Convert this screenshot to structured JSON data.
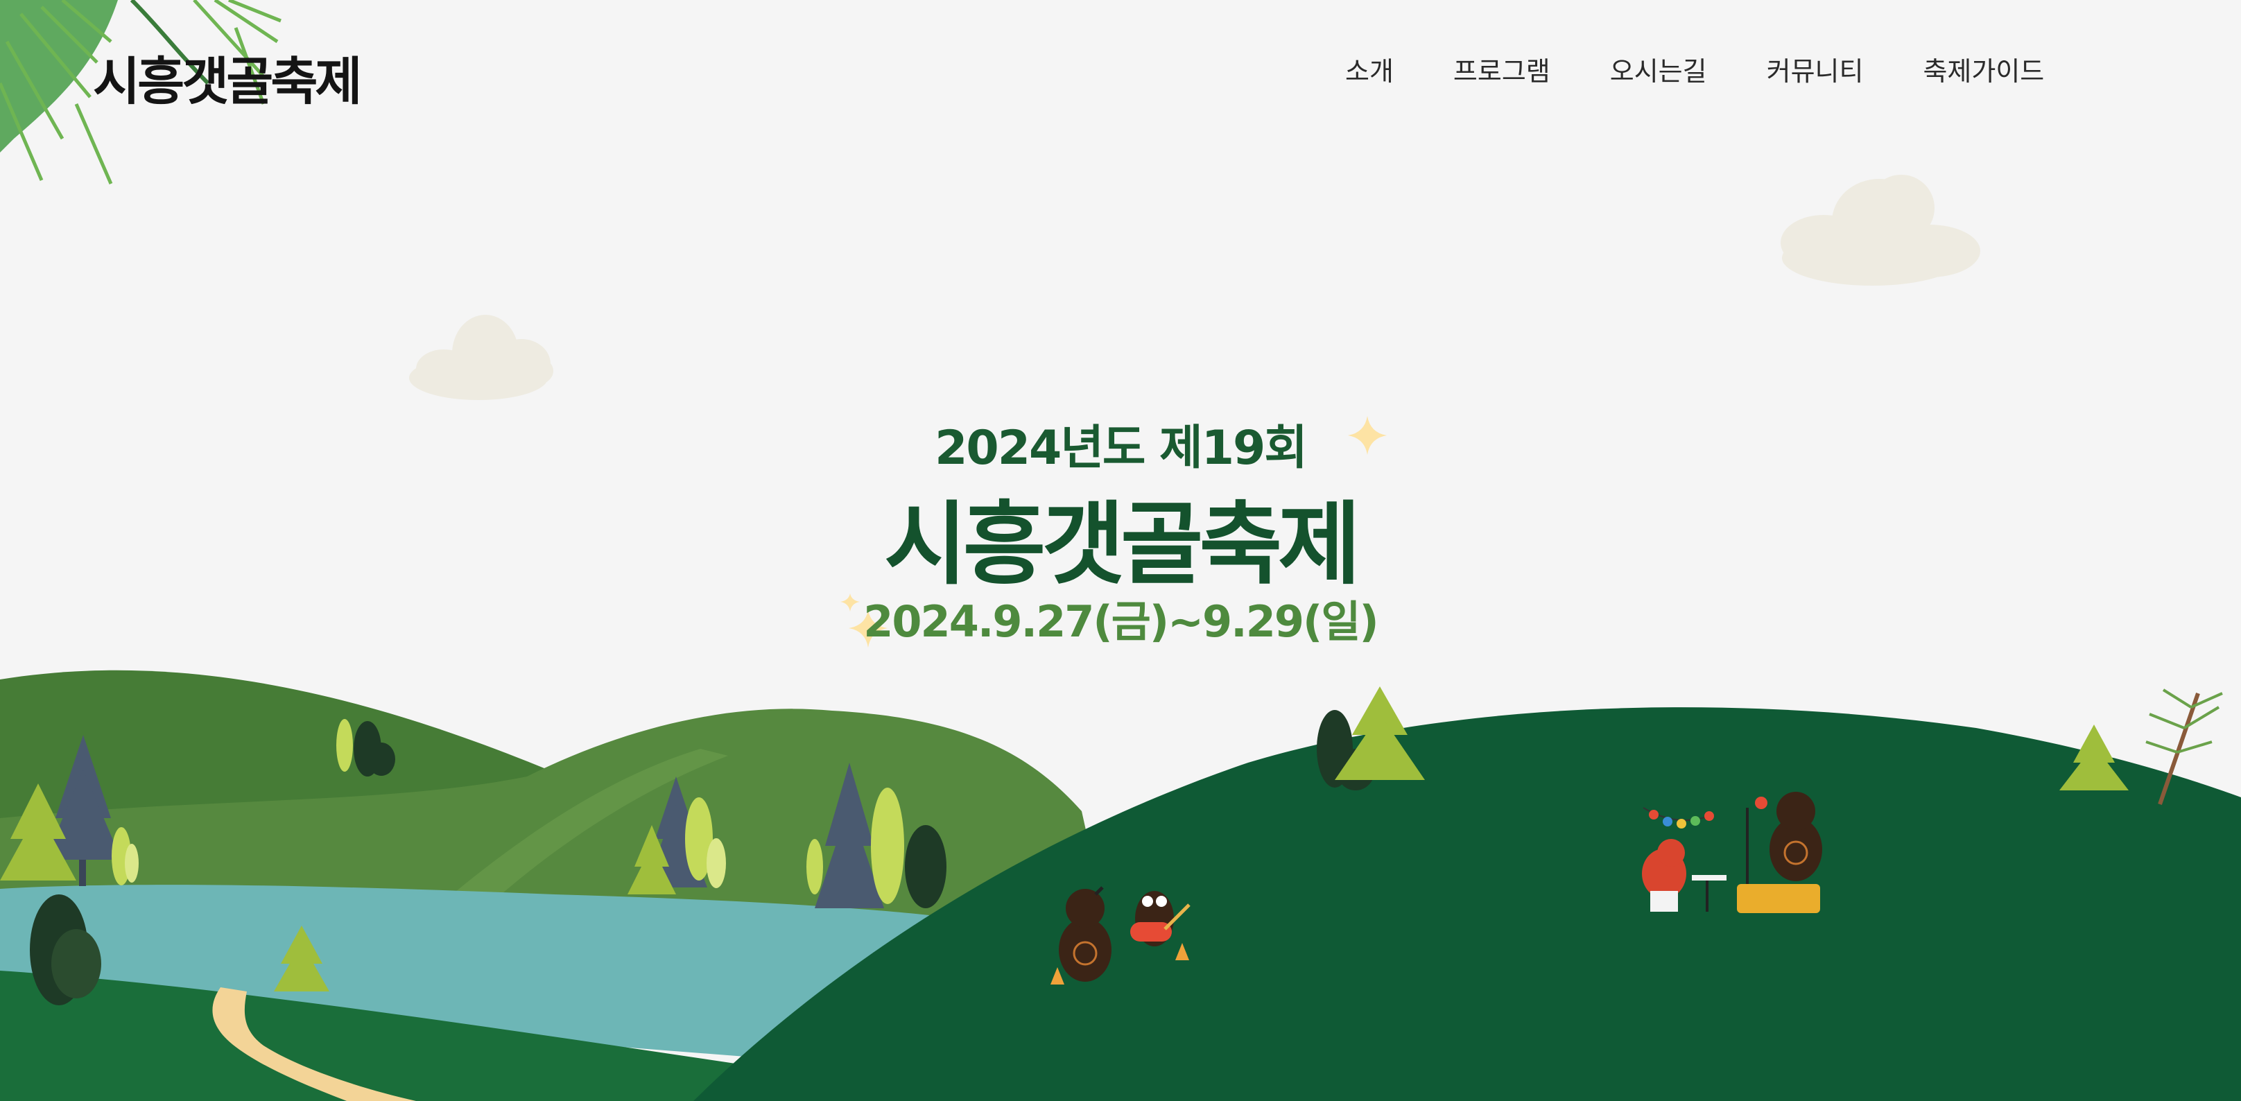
{
  "header": {
    "logo_text": "시흥갯골축제",
    "nav": [
      {
        "label": "소개"
      },
      {
        "label": "프로그램"
      },
      {
        "label": "오시는길"
      },
      {
        "label": "커뮤니티"
      },
      {
        "label": "축제가이드"
      }
    ]
  },
  "hero": {
    "edition": "2024년도 제19회",
    "title": "시흥갯골축제",
    "dates": "2024.9.27(금)~9.29(일)"
  },
  "colors": {
    "background": "#f5f5f5",
    "title_green": "#14522d",
    "date_green": "#4e8a3e",
    "hill_dark": "#0f5a35",
    "river": "#6db6b6",
    "sparkle": "#fde3a4"
  },
  "illustration": {
    "elements": [
      "pine-branch",
      "cloud",
      "sparkle",
      "hills",
      "river",
      "path",
      "pine-tree",
      "bush",
      "bear-musician",
      "owl-guitarist",
      "red-drummer",
      "stage",
      "string-lights"
    ]
  }
}
